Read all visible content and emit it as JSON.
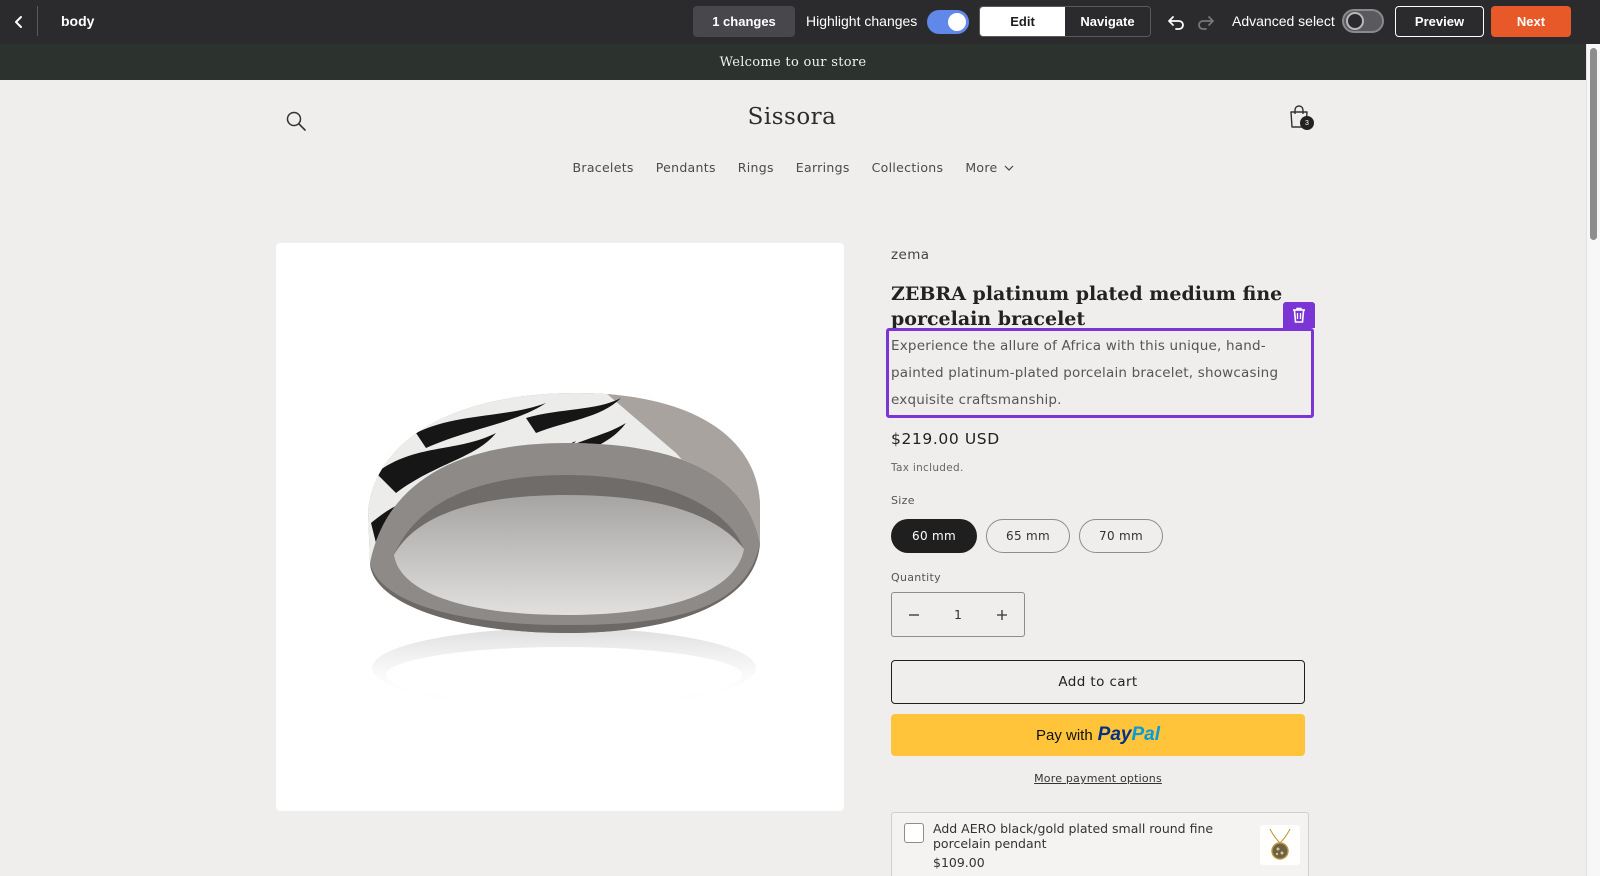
{
  "editor": {
    "breadcrumb": "body",
    "changes_label": "1 changes",
    "highlight_label": "Highlight changes",
    "highlight_on": true,
    "mode_edit": "Edit",
    "mode_navigate": "Navigate",
    "active_mode": "Edit",
    "advanced_select_label": "Advanced select",
    "advanced_select_on": false,
    "preview_label": "Preview",
    "next_label": "Next",
    "colors": {
      "toolbar": "#2b2b2d",
      "accent_next": "#e8592a",
      "toggle_on": "#5f88e8",
      "selection": "#7c35d5"
    }
  },
  "store": {
    "announcement": "Welcome to our store",
    "logo": "Sissora",
    "cart_count": "3",
    "nav": [
      "Bracelets",
      "Pendants",
      "Rings",
      "Earrings",
      "Collections",
      "More"
    ]
  },
  "product": {
    "vendor": "zema",
    "title": "ZEBRA platinum plated medium fine porcelain bracelet",
    "description": "Experience the allure of Africa with this unique, hand-painted platinum-plated porcelain bracelet, showcasing exquisite craftsmanship.",
    "price": "$219.00 USD",
    "tax_note": "Tax included.",
    "size_label": "Size",
    "sizes": [
      "60 mm",
      "65 mm",
      "70 mm"
    ],
    "selected_size": "60 mm",
    "quantity_label": "Quantity",
    "quantity": "1",
    "add_to_cart": "Add to cart",
    "paypal_prefix": "Pay with",
    "paypal_brand_a": "Pay",
    "paypal_brand_b": "Pal",
    "more_payment": "More payment options"
  },
  "upsell": {
    "title": "Add AERO black/gold plated small round fine porcelain pendant",
    "price": "$109.00"
  }
}
